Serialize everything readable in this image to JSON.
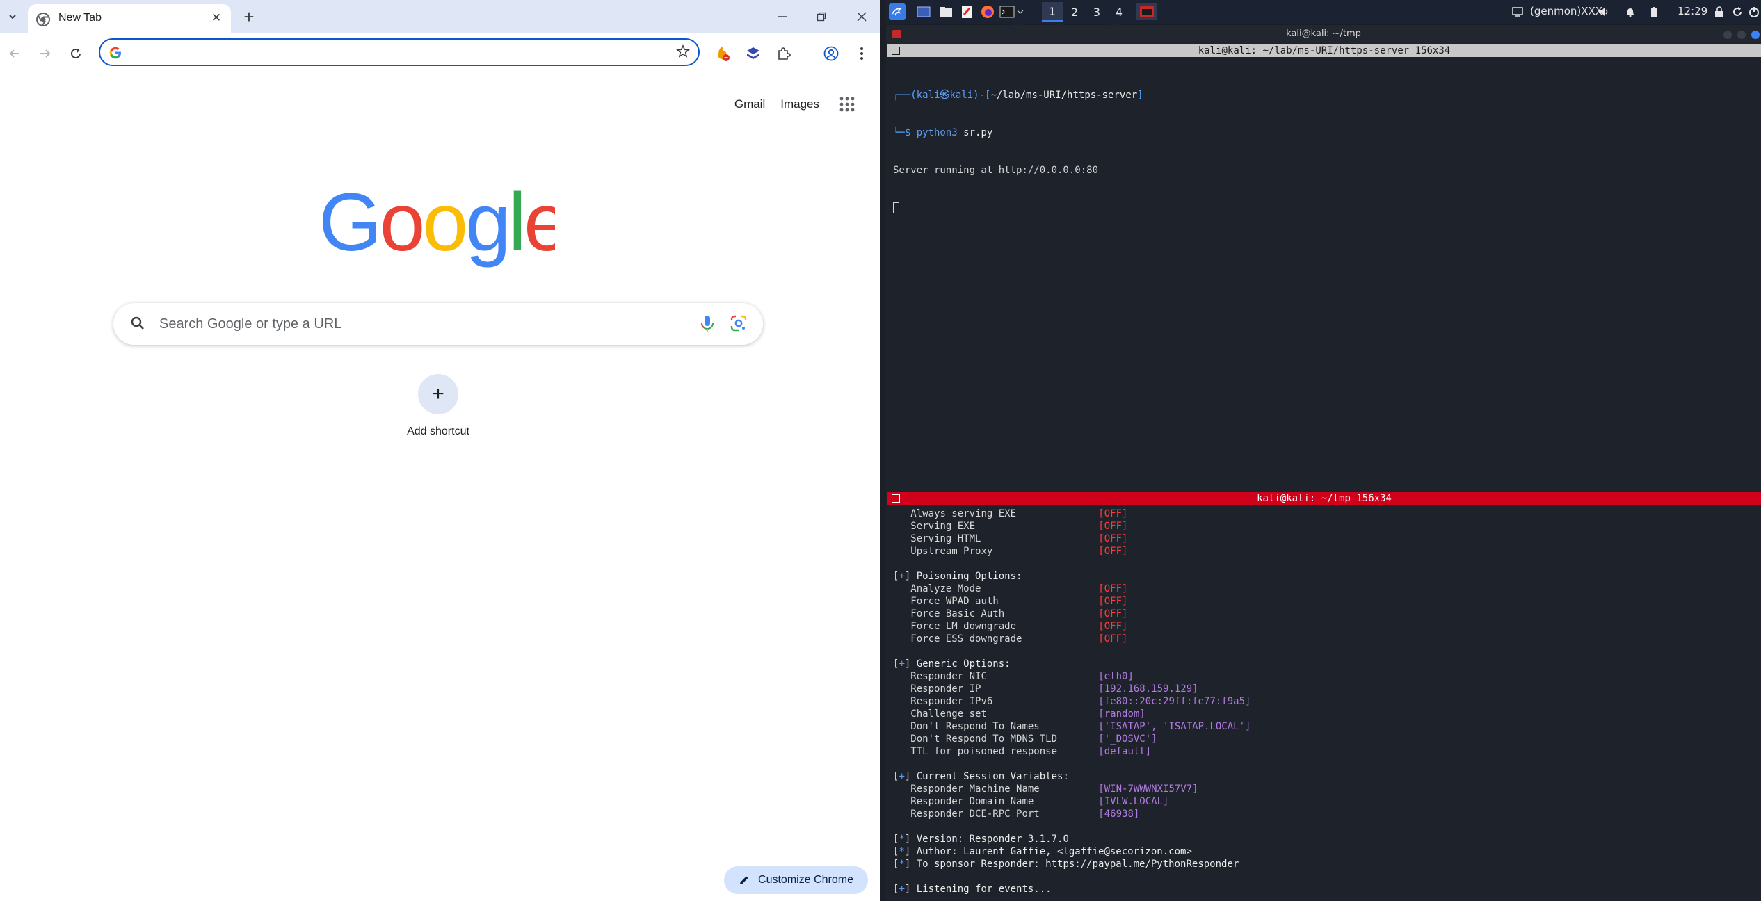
{
  "chrome": {
    "tab": {
      "title": "New Tab"
    },
    "omnibox": {
      "value": "",
      "placeholder": ""
    },
    "top_links": [
      "Gmail",
      "Images"
    ],
    "search": {
      "placeholder": "Search Google or type a URL"
    },
    "shortcut": {
      "label": "Add shortcut"
    },
    "customize_label": "Customize Chrome",
    "logo_text": "Google"
  },
  "kali": {
    "panel": {
      "workspaces": [
        "1",
        "2",
        "3",
        "4"
      ],
      "genmon": "(genmon)XXX",
      "clock": "12:29"
    },
    "window_title": "kali@kali: ~/tmp",
    "top_pane": {
      "title": "kali@kali: ~/lab/ms-URI/https-server 156x34",
      "prompt_user": "kali",
      "prompt_host": "kali",
      "prompt_path": "~/lab/ms-URI/https-server",
      "command": "python3",
      "command_arg": "sr.py",
      "output": "Server running at http://0.0.0.0:80"
    },
    "bottom_pane": {
      "title": "kali@kali: ~/tmp 156x34",
      "servers": [
        {
          "label": "Always serving EXE",
          "value": "[OFF]"
        },
        {
          "label": "Serving EXE",
          "value": "[OFF]"
        },
        {
          "label": "Serving HTML",
          "value": "[OFF]"
        },
        {
          "label": "Upstream Proxy",
          "value": "[OFF]"
        }
      ],
      "poisoning_header": "Poisoning Options:",
      "poisoning": [
        {
          "label": "Analyze Mode",
          "value": "[OFF]"
        },
        {
          "label": "Force WPAD auth",
          "value": "[OFF]"
        },
        {
          "label": "Force Basic Auth",
          "value": "[OFF]"
        },
        {
          "label": "Force LM downgrade",
          "value": "[OFF]"
        },
        {
          "label": "Force ESS downgrade",
          "value": "[OFF]"
        }
      ],
      "generic_header": "Generic Options:",
      "generic": [
        {
          "label": "Responder NIC",
          "value": "[eth0]"
        },
        {
          "label": "Responder IP",
          "value": "[192.168.159.129]"
        },
        {
          "label": "Responder IPv6",
          "value": "[fe80::20c:29ff:fe77:f9a5]"
        },
        {
          "label": "Challenge set",
          "value": "[random]"
        },
        {
          "label": "Don't Respond To Names",
          "value": "['ISATAP', 'ISATAP.LOCAL']"
        },
        {
          "label": "Don't Respond To MDNS TLD",
          "value": "['_DOSVC']"
        },
        {
          "label": "TTL for poisoned response",
          "value": "[default]"
        }
      ],
      "session_header": "Current Session Variables:",
      "session": [
        {
          "label": "Responder Machine Name",
          "value": "[WIN-7WWWNXI57V7]"
        },
        {
          "label": "Responder Domain Name",
          "value": "[IVLW.LOCAL]"
        },
        {
          "label": "Responder DCE-RPC Port",
          "value": "[46938]"
        }
      ],
      "version": "Version: Responder 3.1.7.0",
      "author": "Author: Laurent Gaffie, <lgaffie@secorizon.com>",
      "sponsor": "To sponsor Responder: https://paypal.me/PythonResponder",
      "listening": "Listening for events..."
    }
  },
  "colors": {
    "chrome_accent": "#0b57d0",
    "tabstrip": "#dfe6f5",
    "pane_active_bar": "#d0021b",
    "off_value": "#ff3b3b",
    "option_value": "#b27be3"
  }
}
